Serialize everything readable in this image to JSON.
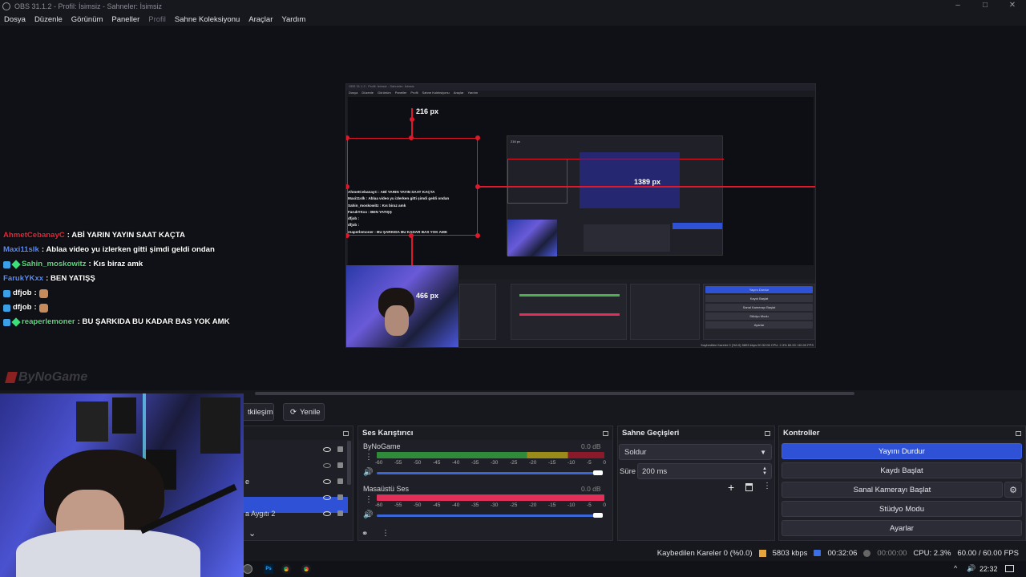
{
  "window": {
    "title": "OBS 31.1.2 - Profil: İsimsiz - Sahneler: İsimsiz"
  },
  "menu": [
    "Dosya",
    "Düzenle",
    "Görünüm",
    "Paneller",
    "Profil",
    "Sahne Koleksiyonu",
    "Araçlar",
    "Yardım"
  ],
  "chat": [
    {
      "user": "AhmetCebanayC",
      "color": "#e0283a",
      "text": ": ABİ YARIN YAYIN SAAT KAÇTA",
      "badges": []
    },
    {
      "user": "Maxi11slk",
      "color": "#5b8df5",
      "text": ": Ablaa video yu izlerken gitti şimdi geldi ondan",
      "badges": []
    },
    {
      "user": "Sahin_moskowitz",
      "color": "#5bd67f",
      "text": ": Kıs biraz amk",
      "badges": [
        "sub",
        "gem"
      ]
    },
    {
      "user": "FarukYKxx",
      "color": "#5b8df5",
      "text": ": BEN YATIŞŞ",
      "badges": []
    },
    {
      "user": "dfjob",
      "color": "#ffffff",
      "text": ":",
      "badges": [
        "sub"
      ],
      "emote": true
    },
    {
      "user": "dfjob",
      "color": "#ffffff",
      "text": ":",
      "badges": [
        "sub"
      ],
      "emote": true
    },
    {
      "user": "reaperlemoner",
      "color": "#5bd67f",
      "text": ": BU ŞARKIDA BU KADAR BAS YOK AMK",
      "badges": [
        "sub",
        "gem"
      ]
    }
  ],
  "brand": "ByNoGame",
  "preview_labels": {
    "top": "216 px",
    "right": "1389 px",
    "bottom": "466 px",
    "inner_top": "216 px"
  },
  "toolbar": {
    "interact": "tkileşim",
    "refresh": "Yenile"
  },
  "sources": {
    "items": [
      "",
      "",
      "e",
      "",
      "a Aygıtı 2"
    ]
  },
  "mixer": {
    "title": "Ses Karıştırıcı",
    "channels": [
      {
        "name": "ByNoGame",
        "db": "0.0 dB"
      },
      {
        "name": "Masaüstü Ses",
        "db": "0.0 dB"
      }
    ],
    "scale": [
      "-60",
      "-55",
      "-50",
      "-45",
      "-40",
      "-35",
      "-30",
      "-25",
      "-20",
      "-15",
      "-10",
      "-5",
      "0"
    ]
  },
  "transitions": {
    "title": "Sahne Geçişleri",
    "selected": "Soldur",
    "duration_label": "Süre",
    "duration": "200 ms"
  },
  "controls": {
    "title": "Kontroller",
    "buttons": [
      "Yayını Durdur",
      "Kaydı Başlat",
      "Sanal Kamerayı Başlat",
      "Stüdyo Modu",
      "Ayarlar"
    ]
  },
  "status": {
    "dropped": "Kaybedilen Kareler 0 (%0.0)",
    "bitrate": "5803 kbps",
    "stream_time": "00:32:06",
    "rec_time": "00:00:00",
    "cpu": "CPU: 2.3%",
    "fps": "60.00 / 60.00 FPS"
  },
  "taskbar": {
    "time": "22:32"
  },
  "nested_chat": [
    "AhmetCebanayC : ABİ YARIN YAYIN SAAT KAÇTA",
    "Maxi11slk : Ablaa video yu izlerken gitti şimdi geldi ondan",
    "Sahin_moskowitz : Kıs biraz amk",
    "FarukYKxx : BEN YATIŞŞ",
    "dfjob :",
    "dfjob :",
    "reaperlemoner : BU ŞARKIDA BU KADAR BAS YOK AMK"
  ],
  "nested_controls": [
    "Yayını Durdur",
    "Kaydı Başlat",
    "Sanal Kamerayı Başlat",
    "Stüdyo Modu",
    "Ayarlar"
  ],
  "nested_status": "Kaybedilen Kareler 0 (%0.0)   5803 kbps   00:32:06   CPU: 2.3%   60.00 / 60.00 FPS"
}
